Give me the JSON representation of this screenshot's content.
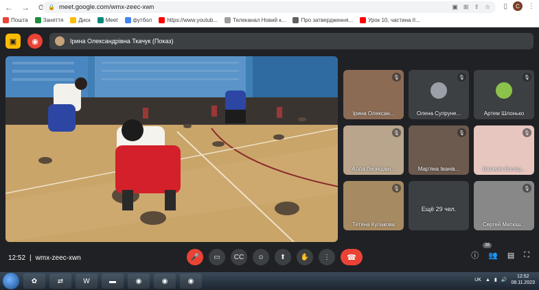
{
  "browser": {
    "url": "meet.google.com/wmx-zeec-xwn",
    "profile_initial": "C",
    "bookmarks": [
      {
        "label": "Пошта",
        "color": "#ea4335"
      },
      {
        "label": "Заняття",
        "color": "#1e8e3e"
      },
      {
        "label": "Диск",
        "color": "#fbbc04"
      },
      {
        "label": "Meet",
        "color": "#00897b"
      },
      {
        "label": "футбол",
        "color": "#4285f4"
      },
      {
        "label": "https://www.youtub...",
        "color": "#ff0000"
      },
      {
        "label": "Телеканал Новий к...",
        "color": "#9e9e9e"
      },
      {
        "label": "Про затвердження...",
        "color": "#616161"
      },
      {
        "label": "Урок 10, частина ІІ...",
        "color": "#ff0000"
      }
    ]
  },
  "meet": {
    "presenter_label": "Ірина Олександрівна Ткачук (Показ)",
    "time": "12:52",
    "meeting_code": "wmx-zeec-xwn",
    "participants_count": "38",
    "tiles": [
      {
        "name": "Ірина Олексан...",
        "bg": "#8c6b55"
      },
      {
        "name": "Олена Супруне...",
        "bg": "#3c4043",
        "avatar": "#9aa0a6"
      },
      {
        "name": "Артем Шлонько",
        "bg": "#3c4043",
        "avatar": "#8bc34a"
      },
      {
        "name": "Алла Леонідівн...",
        "bg": "#b9a58c"
      },
      {
        "name": "Мар'яна Іванів...",
        "bg": "#6d5a4e"
      },
      {
        "name": "Валерія Волод...",
        "bg": "#e8c6c0"
      },
      {
        "name": "Тетяна Кулакова",
        "bg": "#a68a62"
      },
      {
        "name": "Ещё 29 чел.",
        "bg": "#3c4043"
      },
      {
        "name": "Сергей Матюш...",
        "bg": "#888"
      }
    ]
  },
  "taskbar": {
    "lang": "UK",
    "time": "12:52",
    "date": "08.11.2023"
  }
}
